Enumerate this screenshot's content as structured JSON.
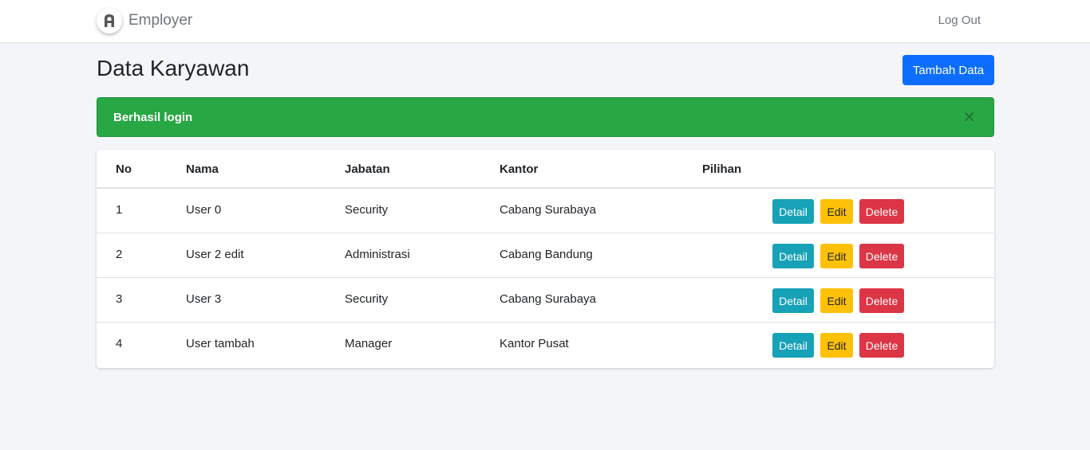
{
  "navbar": {
    "brand": "Employer",
    "logout": "Log Out"
  },
  "page": {
    "title": "Data Karyawan",
    "add_button": "Tambah Data"
  },
  "alert": {
    "message": "Berhasil login",
    "close": "×",
    "color": "#28a745"
  },
  "table": {
    "headers": {
      "no": "No",
      "nama": "Nama",
      "jabatan": "Jabatan",
      "kantor": "Kantor",
      "pilihan": "Pilihan"
    },
    "rows": [
      {
        "no": "1",
        "nama": "User 0",
        "jabatan": "Security",
        "kantor": "Cabang Surabaya"
      },
      {
        "no": "2",
        "nama": "User 2 edit",
        "jabatan": "Administrasi",
        "kantor": "Cabang Bandung"
      },
      {
        "no": "3",
        "nama": "User 3",
        "jabatan": "Security",
        "kantor": "Cabang Surabaya"
      },
      {
        "no": "4",
        "nama": "User tambah",
        "jabatan": "Manager",
        "kantor": "Kantor Pusat"
      }
    ],
    "actions": {
      "detail": "Detail",
      "edit": "Edit",
      "delete": "Delete"
    }
  },
  "colors": {
    "primary": "#0d6efd",
    "info": "#17a2b8",
    "warning": "#ffc107",
    "danger": "#dc3545",
    "success": "#28a745"
  }
}
